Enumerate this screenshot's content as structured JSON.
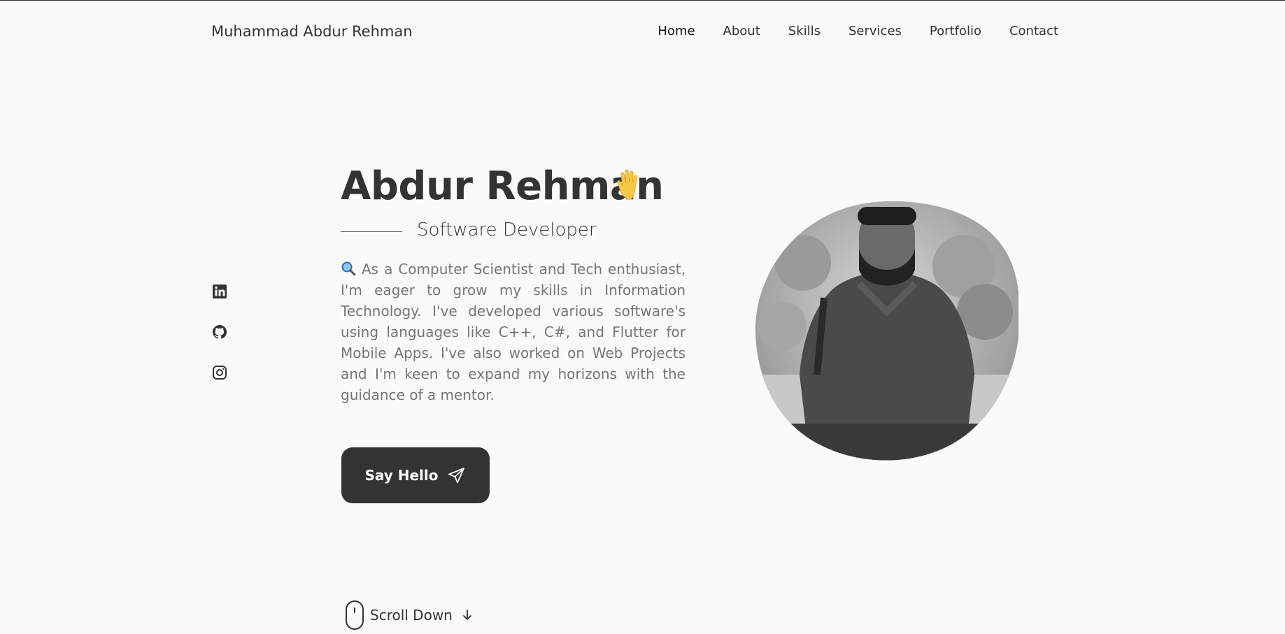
{
  "header": {
    "logo": "Muhammad Abdur Rehman",
    "nav": [
      {
        "label": "Home",
        "active": true
      },
      {
        "label": "About",
        "active": false
      },
      {
        "label": "Skills",
        "active": false
      },
      {
        "label": "Services",
        "active": false
      },
      {
        "label": "Portfolio",
        "active": false
      },
      {
        "label": "Contact",
        "active": false
      }
    ]
  },
  "socials": [
    {
      "icon": "linkedin-icon"
    },
    {
      "icon": "github-icon"
    },
    {
      "icon": "instagram-icon"
    }
  ],
  "hero": {
    "title": "Abdur Rehman",
    "title_emoji": "waving-hand-icon",
    "subtitle": "Software Developer",
    "description_icon": "magnifying-glass-icon",
    "description": "As a Computer Scientist and Tech enthusiast, I'm eager to grow my skills in Information Technology. I've developed various software's using languages like C++, C#, and Flutter for Mobile Apps. I've also worked on Web Projects and I'm keen to expand my horizons with the guidance of a mentor.",
    "button_label": "Say Hello",
    "button_icon": "send-icon"
  },
  "scroll": {
    "label": "Scroll Down",
    "icon": "mouse-icon",
    "arrow_icon": "arrow-down-icon"
  },
  "colors": {
    "background": "#fafafa",
    "text": "#333333",
    "muted_text": "#757575",
    "button": "#333333",
    "button_text": "#ffffff"
  }
}
